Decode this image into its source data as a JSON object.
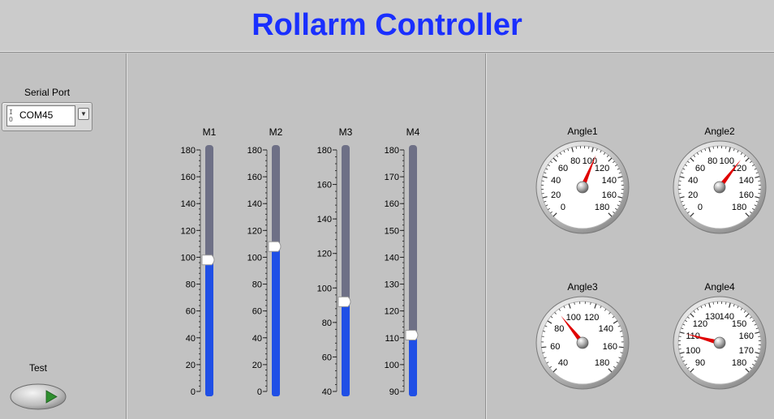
{
  "app": {
    "title": "Rollarm Controller"
  },
  "serial_port": {
    "label": "Serial Port",
    "value": "COM45",
    "io_glyph": "I/O"
  },
  "test_button": {
    "label": "Test",
    "icon": "play-icon"
  },
  "sliders": [
    {
      "label": "M1",
      "min": 0,
      "max": 180,
      "major": 20,
      "minor": 4,
      "value": 98,
      "ticks": [
        "180",
        "160",
        "140",
        "120",
        "100",
        "80",
        "60",
        "40",
        "20",
        "0"
      ]
    },
    {
      "label": "M2",
      "min": 0,
      "max": 180,
      "major": 20,
      "minor": 4,
      "value": 108,
      "ticks": [
        "180",
        "160",
        "140",
        "120",
        "100",
        "80",
        "60",
        "40",
        "20",
        "0"
      ]
    },
    {
      "label": "M3",
      "min": 40,
      "max": 180,
      "major": 20,
      "minor": 4,
      "value": 92,
      "ticks": [
        "180",
        "160",
        "140",
        "120",
        "100",
        "80",
        "60",
        "40"
      ]
    },
    {
      "label": "M4",
      "min": 90,
      "max": 180,
      "major": 10,
      "minor": 2,
      "value": 111,
      "ticks": [
        "180",
        "170",
        "160",
        "150",
        "140",
        "130",
        "120",
        "110",
        "100",
        "90"
      ]
    }
  ],
  "gauges": [
    {
      "label": "Angle1",
      "min": 0,
      "max": 180,
      "value": 105,
      "tick_labels": [
        "0",
        "20",
        "40",
        "60",
        "80",
        "100",
        "120",
        "140",
        "160",
        "180"
      ]
    },
    {
      "label": "Angle2",
      "min": 0,
      "max": 180,
      "value": 115,
      "tick_labels": [
        "0",
        "20",
        "40",
        "60",
        "80",
        "100",
        "120",
        "140",
        "160",
        "180"
      ]
    },
    {
      "label": "Angle3",
      "min": 40,
      "max": 180,
      "value": 90,
      "tick_labels": [
        "40",
        "60",
        "80",
        "100",
        "120",
        "140",
        "160",
        "180"
      ]
    },
    {
      "label": "Angle4",
      "min": 90,
      "max": 180,
      "value": 110,
      "tick_labels": [
        "90",
        "100",
        "110",
        "120",
        "130",
        "140",
        "150",
        "160",
        "170",
        "180"
      ]
    }
  ],
  "colors": {
    "title": "#1a2fff",
    "slider_fill": "#1f4fe6",
    "slider_track": "#6e7086",
    "needle": "#e00000"
  }
}
